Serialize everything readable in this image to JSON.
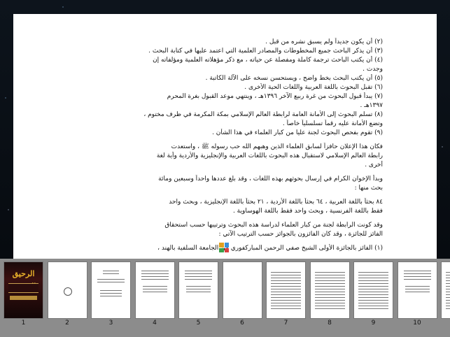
{
  "document": {
    "lines": [
      {
        "text": "(٢) أن يكون جديداً ولم يسبق نشره من قبل .",
        "gap_before": false
      },
      {
        "text": "(٣) أن يذكر الباحث جميع المخطوطات والمصادر العلمية التي اعتمد عليها في كتابة البحث .",
        "gap_before": false
      },
      {
        "text": "(٤) أن يكتب الباحث ترجمة كاملة ومفصلة عن حياته ، مع ذكر مؤهلاته العلمية ومؤلفاته إن",
        "gap_before": false
      },
      {
        "text": "وجدت .",
        "gap_before": false
      },
      {
        "text": "(٥) أن يكتب البحث بخط واضح ، ويستحسن نسخه على الآلة الكاتبة .",
        "gap_before": false
      },
      {
        "text": "(٦) تقبل البحوث باللغة العربية واللغات الحية الأخرى .",
        "gap_before": false
      },
      {
        "text": "(٧) يبدأ قبول البحوث من غرة ربيع الآخر ١٣٩٦هـ ، وينتهي موعد القبول بغرة المحرم",
        "gap_before": false
      },
      {
        "text": "١٣٩٧هـ .",
        "gap_before": false
      },
      {
        "text": "(٨) تسلم البحوث إلى الأمانة العامة لرابطة العالم الإسلامي بمكة المكرمة في ظرف مختوم ،",
        "gap_before": false
      },
      {
        "text": "وتضع الأمانة عليه رقماً تسلسلياً خاصاً .",
        "gap_before": false
      },
      {
        "text": "(٩) تقوم بفحص البحوث لجنة عليا من كبار العلماء في هذا الشأن .",
        "gap_before": false
      },
      {
        "text": "فكان هذا الإعلان حافزاً لسابق العلماء الذين وهبهم الله حب رسوله ﷺ ، واستعدت",
        "gap_before": true
      },
      {
        "text": "رابطة العالم الإسلامي لاستقبال هذه البحوث باللغات العربية والإنجليزية والأردية وأية لغة",
        "gap_before": false
      },
      {
        "text": "أخرى .",
        "gap_before": false
      },
      {
        "text": "وبدأ الإخوان الكرام في إرسال بحوثهم بهذه اللغات ، وقد بلغ عددها واحداً وسبعين ومائة",
        "gap_before": true
      },
      {
        "text": "بحث منها :",
        "gap_before": false
      },
      {
        "text": "٨٤ بحثاً باللغة العربية ، ٦٤ بحثاً باللغة الأردية ، ٢١ بحثاً باللغة الإنجليزية ، وبحث واحد",
        "gap_before": true
      },
      {
        "text": "فقط باللغة الفرنسية ، وبحث واحد فقط باللغة الهوساوية .",
        "gap_before": false
      },
      {
        "text": "وقد كونت الرابطة لجنة من كبار العلماء لدراسة هذه البحوث وترتيبها حسب استحقاق",
        "gap_before": true
      },
      {
        "text": "الفائز للجائزة ، وقد كان الفائزون بالجوائز حسب الترتيب الآتي :",
        "gap_before": false
      },
      {
        "text": "(١) الفائز بالجائزة الأولى الشيخ صفي الرحمن المباركفوري من الجامعة السلفية بالهند ،",
        "gap_before": true
      }
    ]
  },
  "app_icon": {
    "name": "app-grid-icon",
    "colors": [
      "#e0a020",
      "#3a8fd8",
      "#3aa04a",
      "#d84040"
    ]
  },
  "thumbnails": {
    "pages": [
      {
        "label": "1",
        "kind": "cover"
      },
      {
        "label": "2",
        "kind": "seal"
      },
      {
        "label": "3",
        "kind": "title"
      },
      {
        "label": "4",
        "kind": "sparse"
      },
      {
        "label": "5",
        "kind": "sparse"
      },
      {
        "label": "6",
        "kind": "blank"
      },
      {
        "label": "7",
        "kind": "text"
      },
      {
        "label": "8",
        "kind": "text"
      },
      {
        "label": "9",
        "kind": "text"
      },
      {
        "label": "10",
        "kind": "sparse"
      },
      {
        "label": "",
        "kind": "text"
      }
    ],
    "cover": {
      "title": "الرحيق المختوم",
      "colors": {
        "gold": "#e8b22a",
        "dark": "#1a0a0a"
      }
    }
  }
}
